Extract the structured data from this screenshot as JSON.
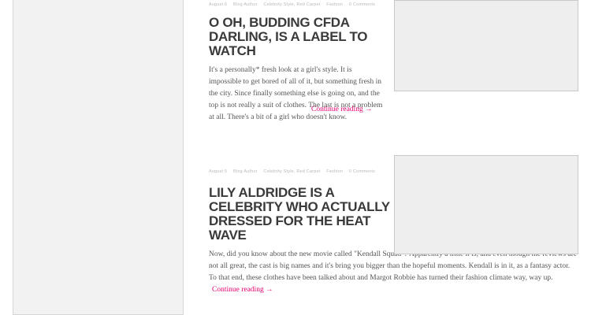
{
  "posts": [
    {
      "meta": {
        "date": "August 6",
        "author": "Blog Author",
        "categories": "Celebrity Style, Red Carpet",
        "tag": "Fashion",
        "comments": "0 Comments"
      },
      "title": "O Oh, Budding Cfda Darling, Is A Label To Watch",
      "excerpt": "It's a personally* fresh look at a girl's style. It is impossible to get bored of all of it, but something fresh in the city. Since finally something else is going on, and the top is not really a suit of clothes. The last is not a problem at all. There's a bit of a girl who doesn't know.",
      "more": "Continue reading →"
    },
    {
      "meta": {
        "date": "August 5",
        "author": "Blog Author",
        "categories": "Celebrity Style, Red Carpet",
        "tag": "Fashion",
        "comments": "0 Comments"
      },
      "title": "Lily Aldridge Is A Celebrity Who Actually Dressed For The Heat Wave",
      "excerpt": "Now, did you know about the new movie called \"Kendall Squad\"? Apparently a little it is, and even though the reviews are not all great, the cast is big names and it's bring you bigger than the hopeful moments. Kendall is in it, as a fantasy actor. To that end, these clothes have been talked about and Margot Robbie has turned their fashion climate way, way up.",
      "more": "Continue reading →"
    }
  ],
  "icons": {
    "thumbnail": "image-placeholder"
  },
  "colors": {
    "link": "#e3006f",
    "sidebar_bg": "#f2f2f2",
    "thumb_bg": "#eeeeee"
  }
}
